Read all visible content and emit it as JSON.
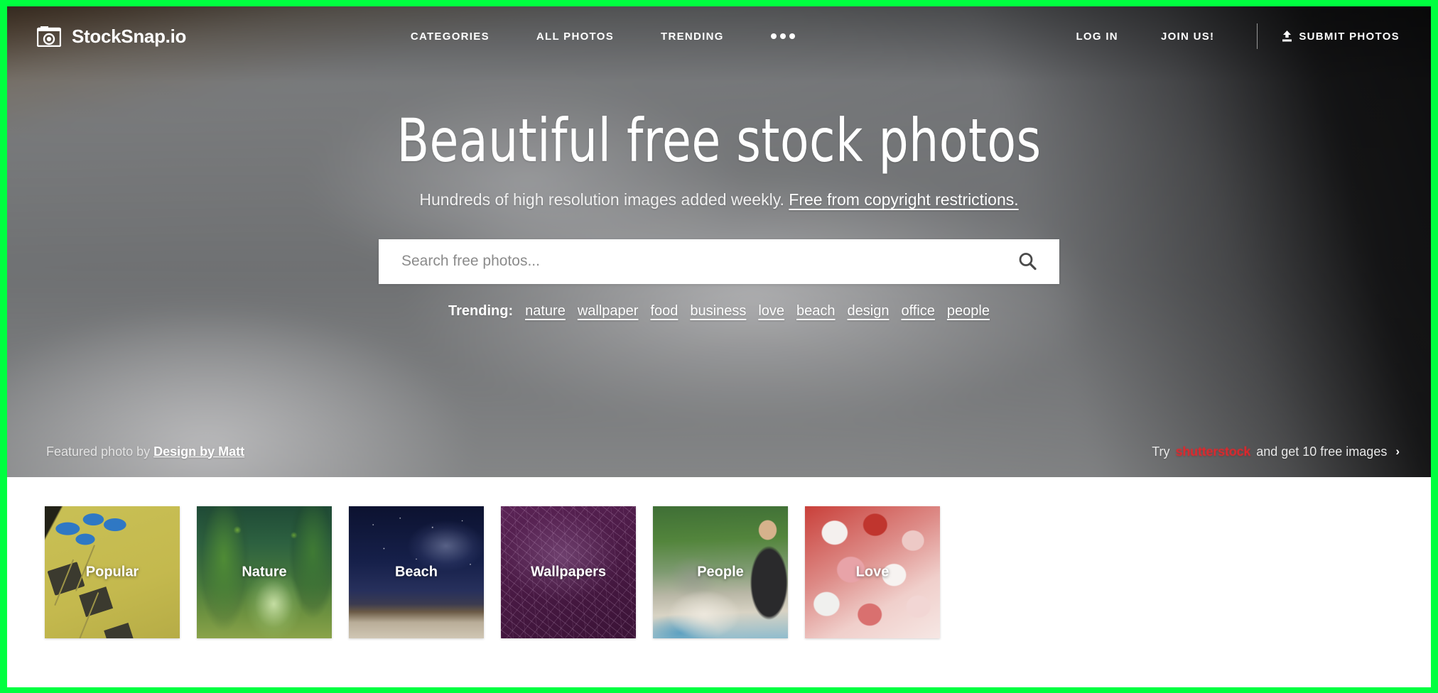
{
  "navbar": {
    "brand_name": "StockSnap.io",
    "brand_icon": "camera-icon",
    "center_links": [
      {
        "label": "CATEGORIES"
      },
      {
        "label": "ALL PHOTOS"
      },
      {
        "label": "TRENDING"
      }
    ],
    "more_icon": "three-dots-icon",
    "login_label": "LOG IN",
    "join_label": "JOIN US!",
    "submit_label": "SUBMIT PHOTOS",
    "submit_icon": "upload-icon"
  },
  "hero": {
    "title": "Beautiful free stock photos",
    "subtitle_text": "Hundreds of high resolution images added weekly.",
    "subtitle_link": "Free from copyright restrictions.",
    "search": {
      "placeholder": "Search free photos...",
      "value": "",
      "icon": "search-icon"
    },
    "trending": {
      "label": "Trending:",
      "tags": [
        "nature",
        "wallpaper",
        "food",
        "business",
        "love",
        "beach",
        "design",
        "office",
        "people"
      ]
    },
    "footer": {
      "credit_prefix": "Featured photo by",
      "credit_name": "Design by Matt",
      "promo_prefix": "Try",
      "promo_brand": "shutterstock",
      "promo_suffix": "and get 10 free images",
      "promo_arrow": "›"
    }
  },
  "categories": [
    {
      "label": "Popular",
      "art": "art-popular"
    },
    {
      "label": "Nature",
      "art": "art-nature"
    },
    {
      "label": "Beach",
      "art": "art-beach"
    },
    {
      "label": "Wallpapers",
      "art": "art-wallpapers"
    },
    {
      "label": "People",
      "art": "art-people"
    },
    {
      "label": "Love",
      "art": "art-love"
    }
  ],
  "colors": {
    "capture_border": "#00ff40",
    "promo_brand": "#e8252a",
    "hero_overlay": "#6d6f70",
    "text_white": "#ffffff"
  }
}
